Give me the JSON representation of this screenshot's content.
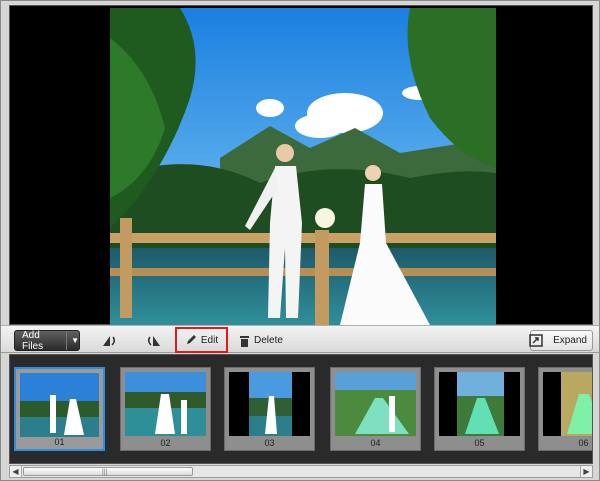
{
  "toolbar": {
    "add_files_label": "Add Files",
    "edit_label": "Edit",
    "delete_label": "Delete",
    "expand_label": "Expand",
    "icons": {
      "rotate_left": "rotate-left-icon",
      "rotate_right": "rotate-right-icon",
      "edit": "pencil-icon",
      "delete": "trash-icon",
      "expand": "expand-icon"
    },
    "highlight_color": "#e01b1b"
  },
  "filmstrip": {
    "selected": "01",
    "selected_color": "#2a8fe0",
    "items": [
      {
        "label": "01"
      },
      {
        "label": "02"
      },
      {
        "label": "03"
      },
      {
        "label": "04"
      },
      {
        "label": "05"
      },
      {
        "label": "06"
      }
    ]
  },
  "scrollbar": {
    "grip": "|||"
  }
}
